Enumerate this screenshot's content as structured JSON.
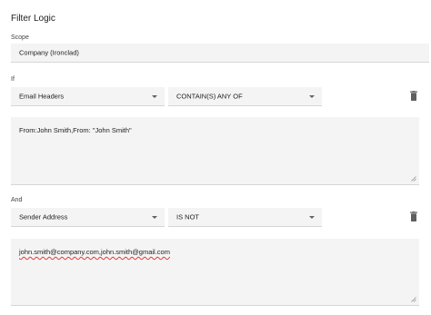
{
  "title": "Filter Logic",
  "scope": {
    "label": "Scope",
    "value": "Company (Ironclad)"
  },
  "if_rule": {
    "label": "If",
    "field": "Email Headers",
    "operator": "CONTAIN(S) ANY OF",
    "value": "From:John Smith,From: \"John Smith\""
  },
  "and_rule": {
    "label": "And",
    "field": "Sender Address",
    "operator": "IS NOT",
    "value": "john.smith@company.com,john.smith@gmail.com"
  },
  "icons": {
    "delete": "trash-icon",
    "dropdown": "chevron-down-icon",
    "resize": "resize-grip-icon"
  },
  "colors": {
    "field_bg": "#f4f4f4",
    "icon": "#616161"
  }
}
